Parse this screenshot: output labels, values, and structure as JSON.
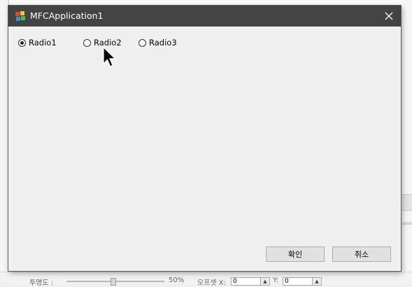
{
  "window": {
    "title": "MFCApplication1",
    "icon": "mfc-app-icon",
    "close_icon": "close-icon"
  },
  "radios": [
    {
      "label": "Radio1",
      "checked": true
    },
    {
      "label": "Radio2",
      "checked": false
    },
    {
      "label": "Radio3",
      "checked": false
    }
  ],
  "buttons": {
    "ok_label": "확인",
    "cancel_label": "취소"
  },
  "background": {
    "opacity_label": "투명도 :",
    "opacity_value": "50%",
    "offset_label": "오프셋 X:",
    "offset_x": "0",
    "offset_y_label": "Y:",
    "offset_y": "0"
  },
  "colors": {
    "titlebar": "#434343",
    "window_bg": "#f0f0f0",
    "button_bg": "#e1e1e1"
  }
}
